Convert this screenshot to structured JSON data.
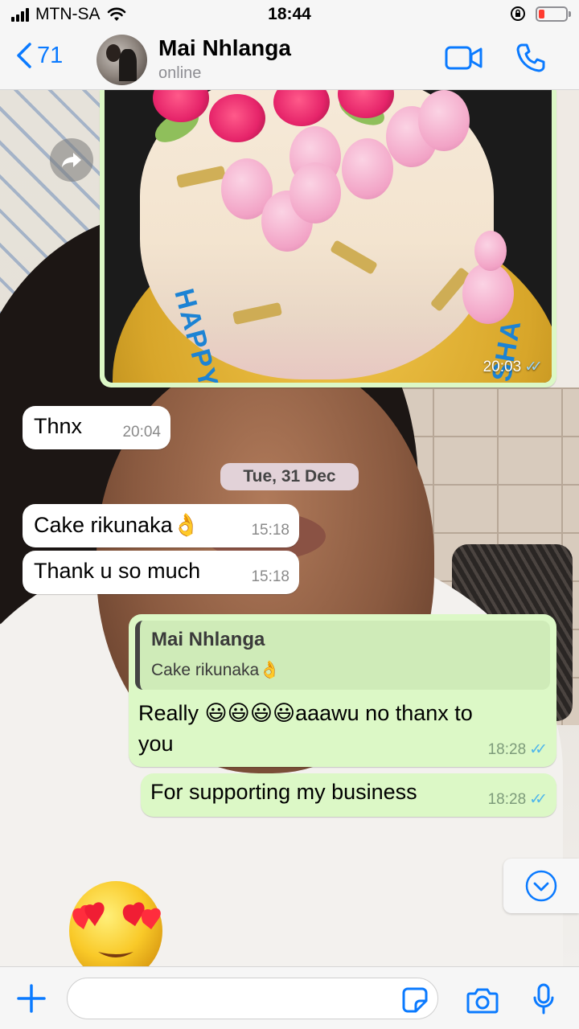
{
  "status_bar": {
    "carrier": "MTN-SA",
    "time": "18:44"
  },
  "header": {
    "back_count": "71",
    "contact_name": "Mai Nhlanga",
    "contact_status": "online"
  },
  "messages": {
    "image": {
      "time": "20:03",
      "cake_text_left": "HAPPY",
      "cake_text_right": "ISHA"
    },
    "thnx": {
      "text": "Thnx",
      "time": "20:04"
    },
    "date_separator": "Tue, 31 Dec",
    "cake": {
      "text": "Cake rikunaka👌",
      "time": "15:18"
    },
    "thanks": {
      "text": "Thank u so much",
      "time": "15:18"
    },
    "reply": {
      "quoted_name": "Mai Nhlanga",
      "quoted_text": "Cake rikunaka👌",
      "text_line1": "Really 😃😃😃😃aaawu no thanx to",
      "text_line2": "you",
      "time": "18:28"
    },
    "support": {
      "text": "For supporting my business",
      "time": "18:28"
    }
  },
  "input": {
    "placeholder": ""
  },
  "colors": {
    "accent": "#0a7aff",
    "outgoing_bubble": "#dcf8c6",
    "incoming_bubble": "#ffffff",
    "read_ticks": "#4fb6ec",
    "battery_low": "#ff3b30"
  },
  "icons": {
    "back": "chevron-left-icon",
    "video": "video-camera-icon",
    "call": "phone-icon",
    "forward": "forward-arrow-icon",
    "scroll": "chevron-down-circle-icon",
    "attach": "plus-icon",
    "sticker": "sticker-icon",
    "camera": "camera-icon",
    "mic": "microphone-icon",
    "big_emoji": "heart-eyes-emoji"
  }
}
